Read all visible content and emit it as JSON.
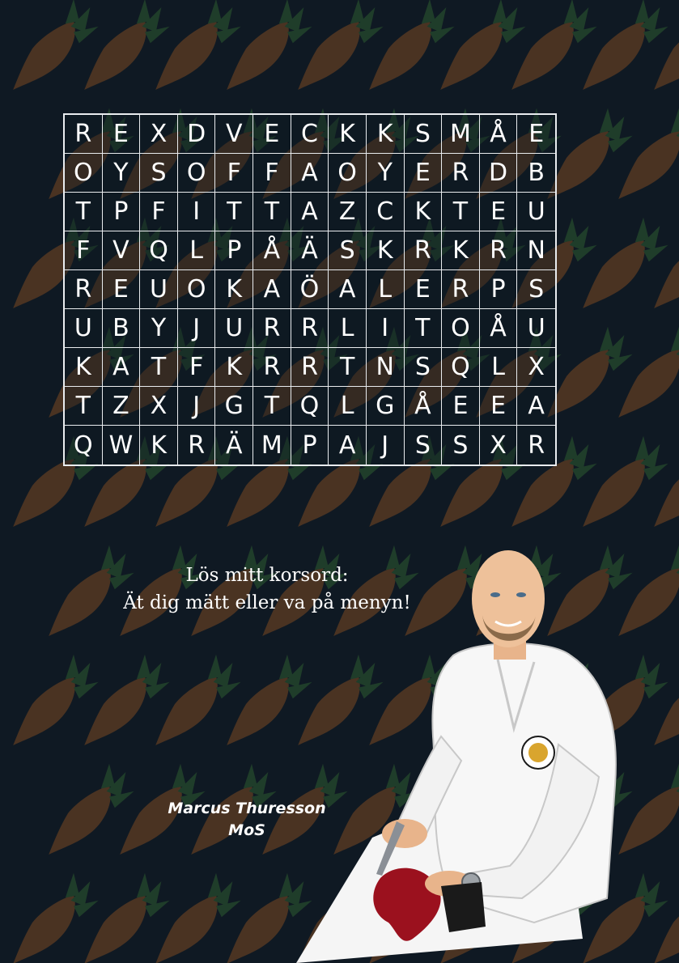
{
  "puzzle": {
    "rows": [
      [
        "R",
        "E",
        "X",
        "D",
        "V",
        "E",
        "C",
        "K",
        "K",
        "S",
        "M",
        "Å",
        "E"
      ],
      [
        "O",
        "Y",
        "S",
        "O",
        "F",
        "F",
        "A",
        "O",
        "Y",
        "E",
        "R",
        "D",
        "B"
      ],
      [
        "T",
        "P",
        "F",
        "I",
        "T",
        "T",
        "A",
        "Z",
        "C",
        "K",
        "T",
        "E",
        "U"
      ],
      [
        "F",
        "V",
        "Q",
        "L",
        "P",
        "Å",
        "Ä",
        "S",
        "K",
        "R",
        "K",
        "R",
        "N"
      ],
      [
        "R",
        "E",
        "U",
        "O",
        "K",
        "A",
        "Ö",
        "A",
        "L",
        "E",
        "R",
        "P",
        "S"
      ],
      [
        "U",
        "B",
        "Y",
        "J",
        "U",
        "R",
        "R",
        "L",
        "I",
        "T",
        "O",
        "Å",
        "U"
      ],
      [
        "K",
        "A",
        "T",
        "F",
        "K",
        "R",
        "R",
        "T",
        "N",
        "S",
        "Q",
        "L",
        "X"
      ],
      [
        "T",
        "Z",
        "X",
        "J",
        "G",
        "T",
        "Q",
        "L",
        "G",
        "Å",
        "E",
        "E",
        "A"
      ],
      [
        "Q",
        "W",
        "K",
        "R",
        "Ä",
        "M",
        "P",
        "A",
        "J",
        "S",
        "S",
        "X",
        "R"
      ]
    ]
  },
  "tagline": {
    "line1": "Lös mitt korsord:",
    "line2": "Ät dig mätt eller va på menyn!"
  },
  "author": {
    "name": "Marcus Thuresson",
    "title": "MoS"
  },
  "colors": {
    "background": "#0f1923",
    "carrot": "#4a3322",
    "carrot_leaf": "#1f3d2a",
    "grid_line": "#e9ecef",
    "text": "#ffffff"
  },
  "illustration": {
    "icon": "chef-with-knife-illustration",
    "pattern": "carrot-pattern"
  }
}
